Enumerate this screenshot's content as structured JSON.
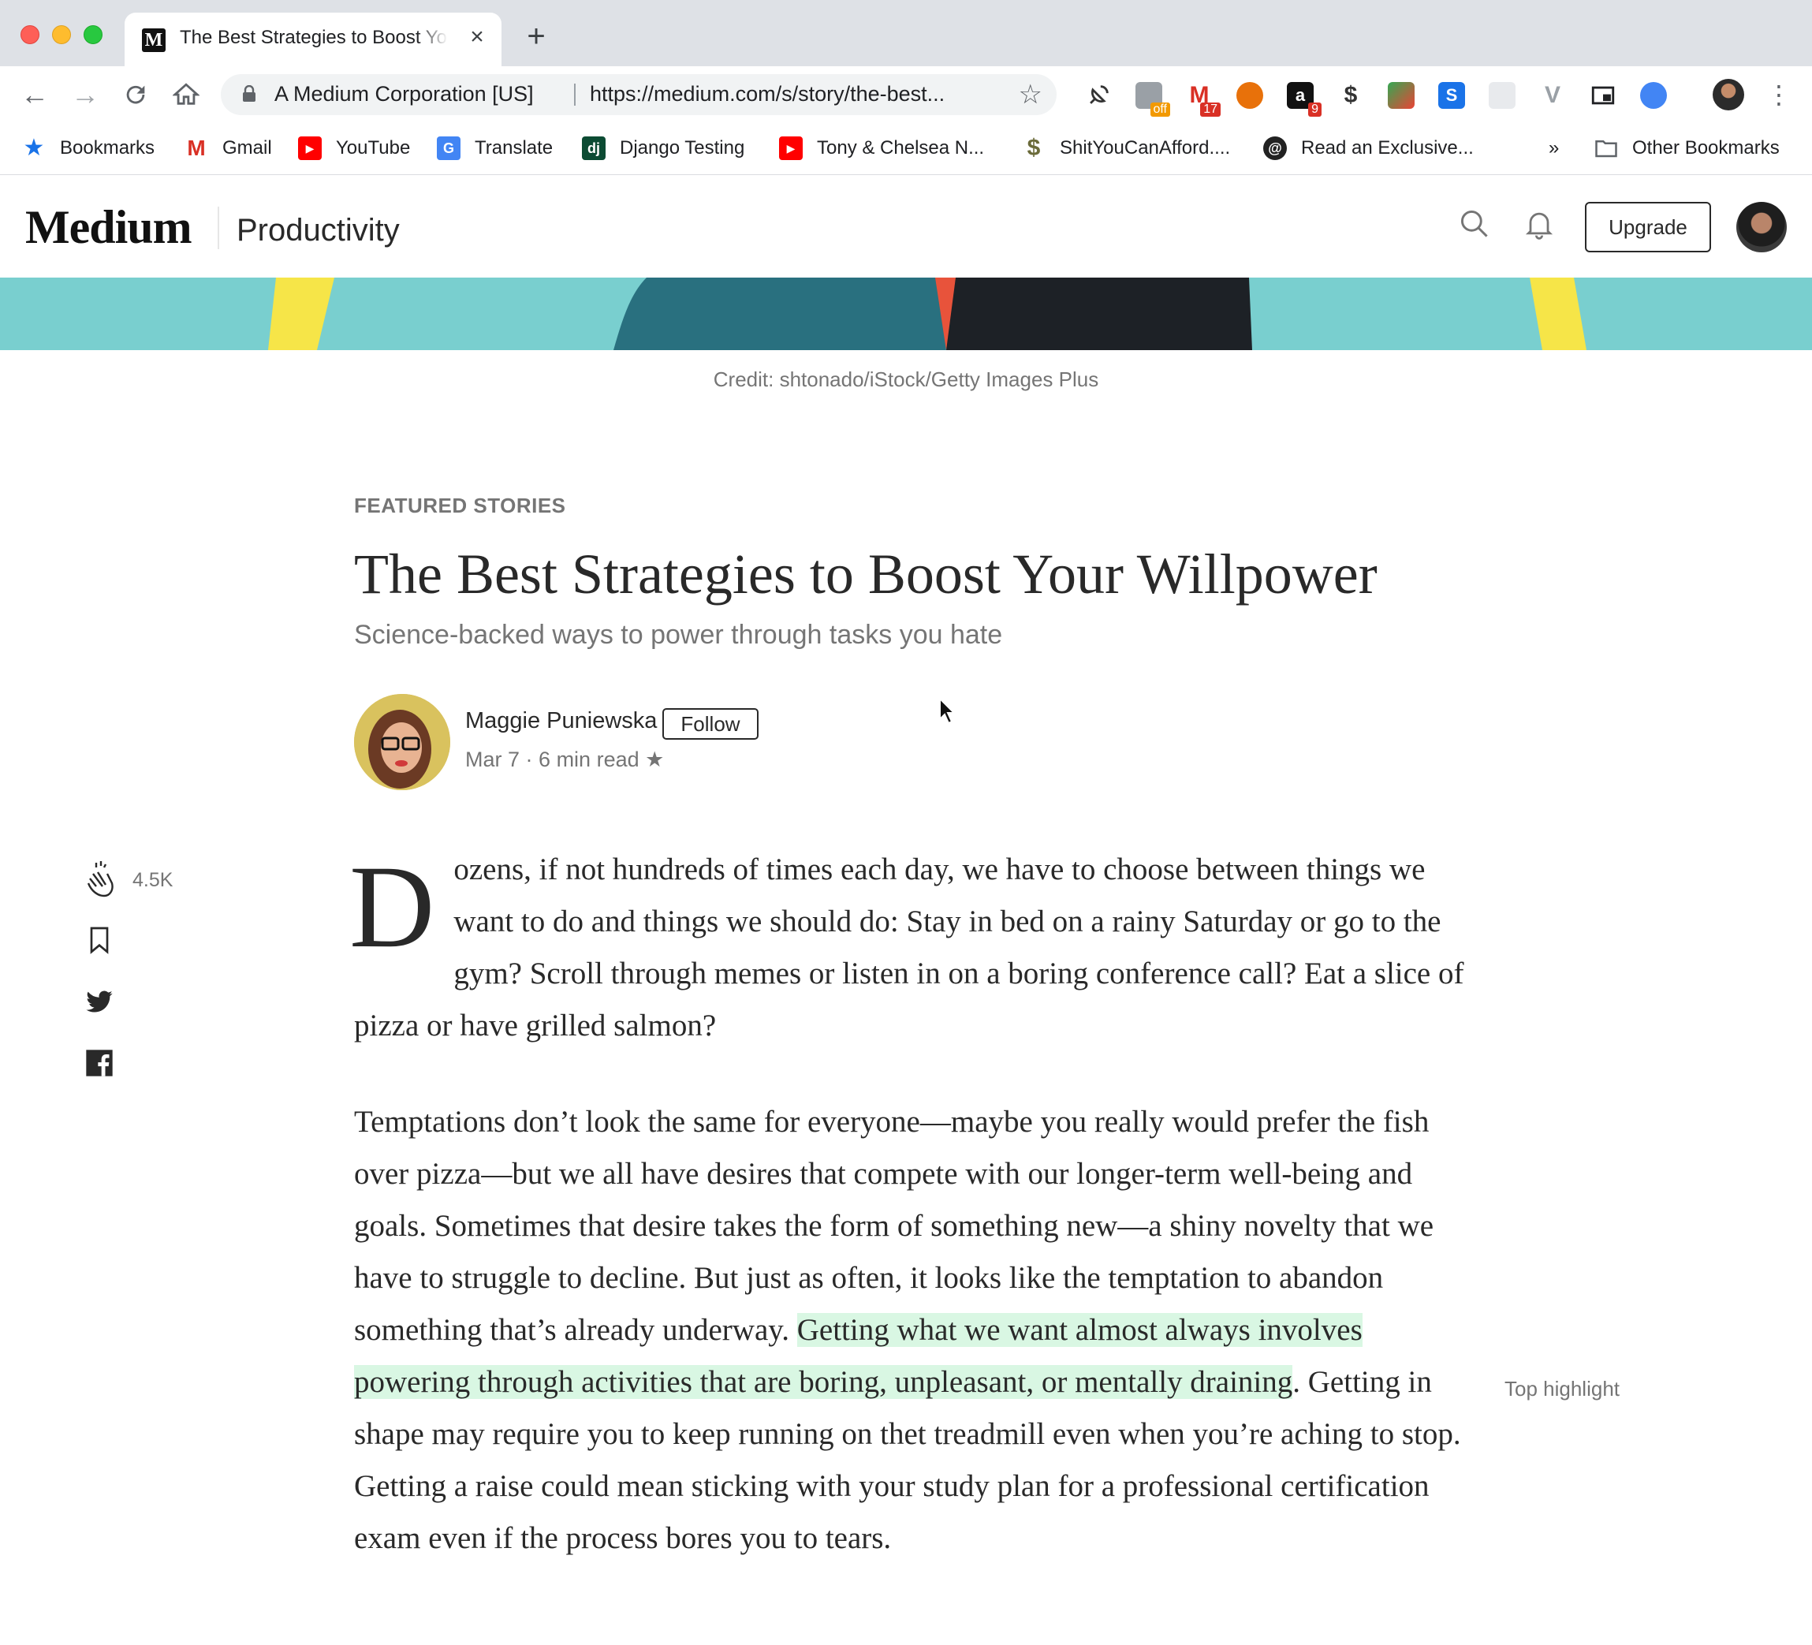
{
  "browser": {
    "tab_title": "The Best Strategies to Boost Your Willpower",
    "site_identity": "A Medium Corporation [US]",
    "url": "https://medium.com/s/story/the-best...",
    "extensions": [
      {
        "name": "ext-1",
        "badge": ""
      },
      {
        "name": "ext-2",
        "badge": "off"
      },
      {
        "name": "gmail-ext",
        "badge": "17"
      },
      {
        "name": "ext-4",
        "badge": ""
      },
      {
        "name": "amazon-ext",
        "badge": "9"
      },
      {
        "name": "dollar-ext",
        "badge": ""
      }
    ],
    "bookmarks": [
      {
        "label": "Bookmarks",
        "icon": "star-icon",
        "color": "#1a73e8"
      },
      {
        "label": "Gmail",
        "icon": "gmail-icon",
        "color": "#d93025"
      },
      {
        "label": "YouTube",
        "icon": "youtube-icon",
        "color": "#ff0000"
      },
      {
        "label": "Translate",
        "icon": "translate-icon",
        "color": "#4285f4"
      },
      {
        "label": "Django Testing",
        "icon": "django-icon",
        "color": "#0c4b33"
      },
      {
        "label": "Tony & Chelsea N...",
        "icon": "youtube-icon",
        "color": "#ff0000"
      },
      {
        "label": "ShitYouCanAfford....",
        "icon": "dollar-icon",
        "color": "#6b6b3a"
      },
      {
        "label": "Read an Exclusive...",
        "icon": "site-icon",
        "color": "#222222"
      }
    ],
    "overflow_label": "»",
    "other_bookmarks": "Other Bookmarks"
  },
  "header": {
    "logo": "Medium",
    "publication": "Productivity",
    "upgrade_label": "Upgrade"
  },
  "hero": {
    "caption": "Credit: shtonado/iStock/Getty Images Plus"
  },
  "article": {
    "kicker": "FEATURED STORIES",
    "title": "The Best Strategies to Boost Your Willpower",
    "subtitle": "Science-backed ways to power through tasks you hate",
    "author": "Maggie Puniewska",
    "follow_label": "Follow",
    "date": "Mar 7",
    "read_time": "6 min read",
    "claps": "4.5K",
    "dropcap": "D",
    "p1_rest": "ozens, if not hundreds of times each day, we have to choose between things we want to do and things we should do: Stay in bed on a rainy Saturday or go to the gym? Scroll through memes or listen in on a boring conference call? Eat a slice of pizza or have grilled salmon?",
    "p2_before": "Temptations don’t look the same for everyone—maybe you really would prefer the fish over pizza—but we all have desires that compete with our longer-term well-being and goals. Sometimes that desire takes the form of something new—a shiny novelty that we have to struggle to decline. But just as often, it looks like the temptation to abandon something that’s already underway. ",
    "p2_highlight": "Getting what we want almost always involves powering through activities that are boring, unpleasant, or mentally draining",
    "p2_after": ". Getting in shape may require you to keep running on thet treadmill even when you’re aching to stop. Getting a raise could mean sticking with your study plan for a professional certification exam even if the process bores you to tears.",
    "top_highlight_label": "Top highlight"
  },
  "colors": {
    "highlight": "#d9f7e3",
    "hero_teal": "#79cfcf"
  }
}
